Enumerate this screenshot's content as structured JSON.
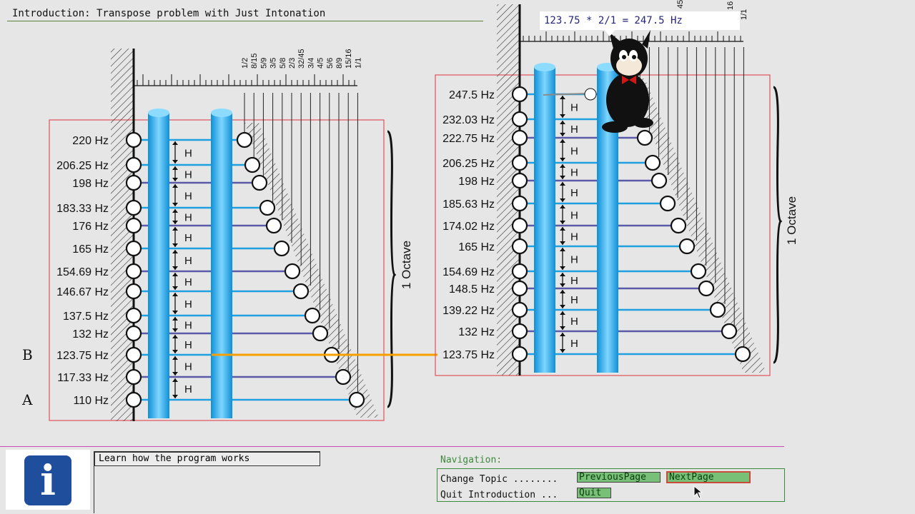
{
  "header": {
    "title": "Introduction: Transpose problem with Just Intonation"
  },
  "tooltip": {
    "text": "123.75 * 2/1 = 247.5 Hz"
  },
  "left_diagram": {
    "frequencies": [
      "220 Hz",
      "206.25 Hz",
      "198 Hz",
      "183.33 Hz",
      "176 Hz",
      "165 Hz",
      "154.69 Hz",
      "146.67 Hz",
      "137.5 Hz",
      "132 Hz",
      "123.75 Hz",
      "117.33 Hz",
      "110 Hz"
    ],
    "ratios": [
      "1/2",
      "8/15",
      "5/9",
      "3/5",
      "5/8",
      "2/3",
      "32/45",
      "3/4",
      "4/5",
      "5/6",
      "8/9",
      "15/16",
      "1/1"
    ],
    "step_label": "H",
    "octave_label": "1 Octave",
    "marker_b": "B",
    "marker_a": "A"
  },
  "right_diagram": {
    "frequencies": [
      "247.5 Hz",
      "232.03 Hz",
      "222.75 Hz",
      "206.25 Hz",
      "198 Hz",
      "185.63 Hz",
      "174.02 Hz",
      "165 Hz",
      "154.69 Hz",
      "148.5 Hz",
      "139.22 Hz",
      "132 Hz",
      "123.75 Hz"
    ],
    "ratios_visible": [
      "45",
      "16",
      "1/1"
    ],
    "step_label": "H",
    "octave_label": "1 Octave"
  },
  "help": {
    "text": "Learn how the program works"
  },
  "navigation": {
    "heading": "Navigation:",
    "change_topic_label": "Change Topic ........",
    "quit_label": "Quit Introduction ...",
    "previous_button": "PreviousPage",
    "next_button": "NextPage",
    "quit_button": "Quit"
  },
  "colors": {
    "frame": "#e0525a",
    "pipe": "#2aa8e6",
    "line_cyan": "#1fa0e0",
    "line_purple": "#5a5aa8",
    "orange": "#f5a000",
    "nav_green": "#3c8a3c"
  },
  "icons": [
    "info-icon",
    "mouse-cursor-icon",
    "cat-mascot"
  ]
}
